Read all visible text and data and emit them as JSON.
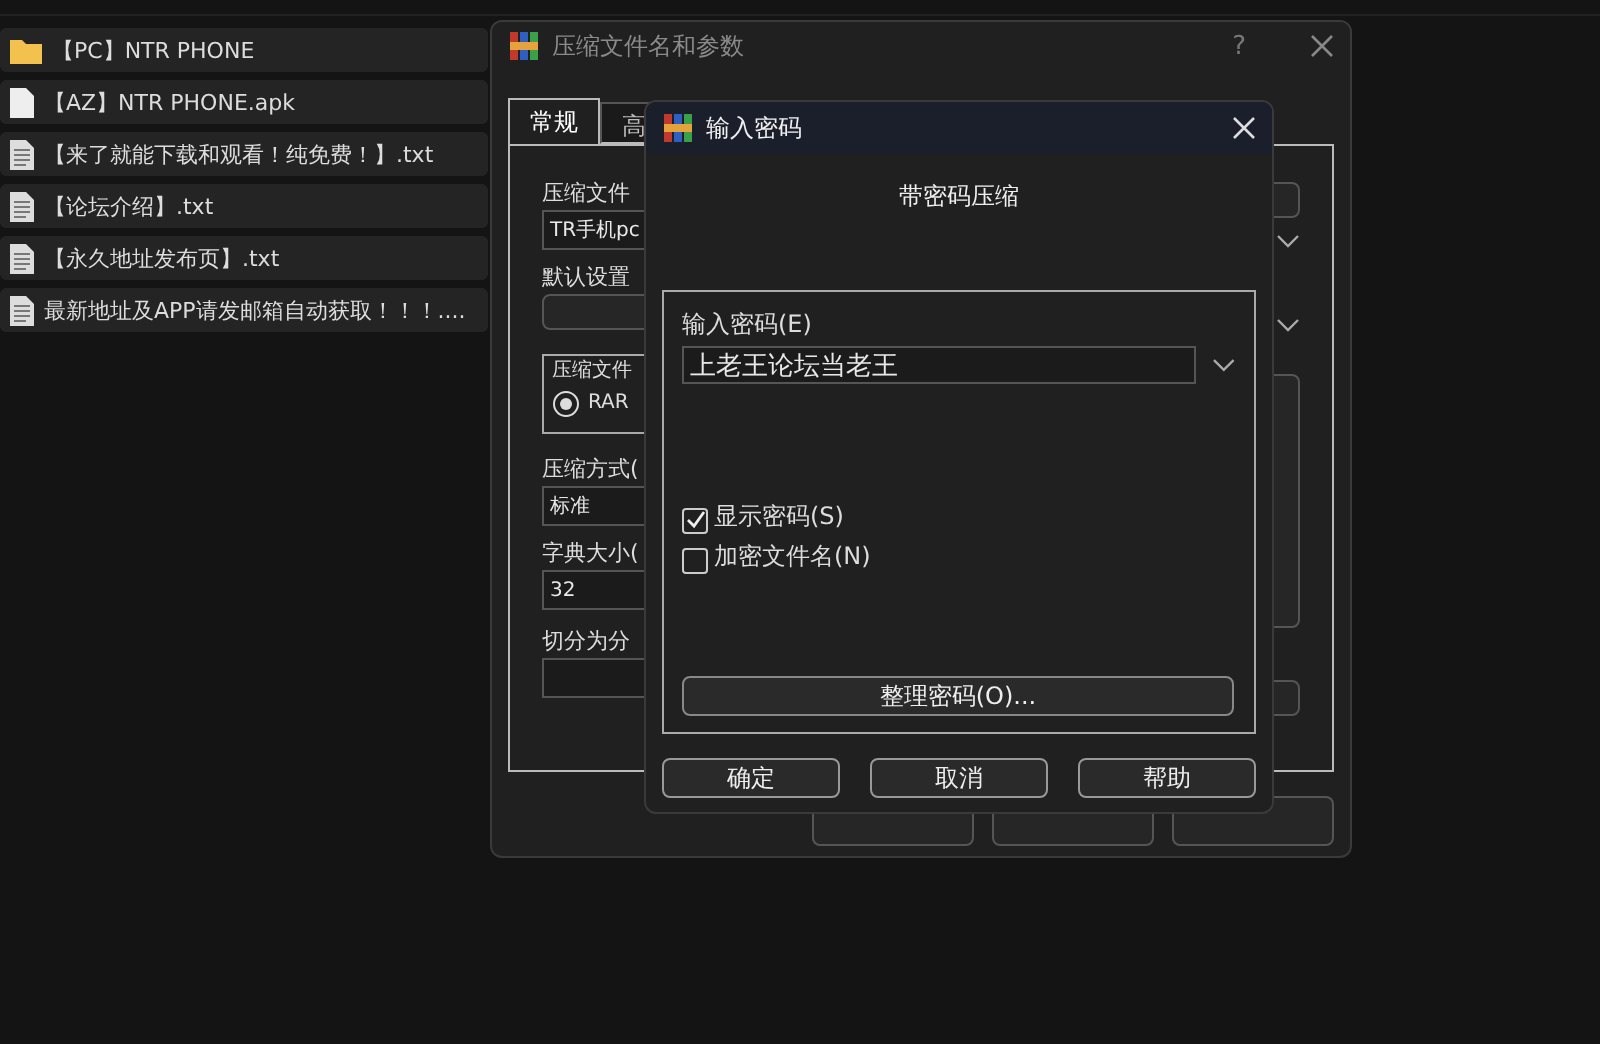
{
  "files": [
    {
      "name": "【PC】NTR PHONE",
      "kind": "folder"
    },
    {
      "name": "【AZ】NTR PHONE.apk",
      "kind": "file"
    },
    {
      "name": "【来了就能下载和观看！纯免费！】.txt",
      "kind": "text"
    },
    {
      "name": "【论坛介绍】.txt",
      "kind": "text"
    },
    {
      "name": "【永久地址发布页】.txt",
      "kind": "text"
    },
    {
      "name": "最新地址及APP请发邮箱自动获取！！！....",
      "kind": "text"
    }
  ],
  "back_dialog": {
    "title": "压缩文件名和参数",
    "help": "?",
    "tabs": [
      {
        "label": "常规",
        "selected": true
      },
      {
        "label": "高",
        "selected": false
      }
    ],
    "archive_name_label": "压缩文件",
    "archive_name_value": "TR手机pc",
    "default_label": "默认设置",
    "format_group_label": "压缩文件",
    "format_option": {
      "label": "RAR",
      "selected": true
    },
    "method_label": "压缩方式(",
    "method_value": "标准",
    "dict_label": "字典大小(",
    "dict_value": "32",
    "split_label": "切分为分"
  },
  "password_dialog": {
    "title": "输入密码",
    "heading": "带密码压缩",
    "password_label": "输入密码(E)",
    "password_value": "上老王论坛当老王",
    "checkboxes": [
      {
        "label": "显示密码(S)",
        "checked": true
      },
      {
        "label": "加密文件名(N)",
        "checked": false
      }
    ],
    "organize_button": "整理密码(O)...",
    "buttons": [
      "确定",
      "取消",
      "帮助"
    ]
  }
}
